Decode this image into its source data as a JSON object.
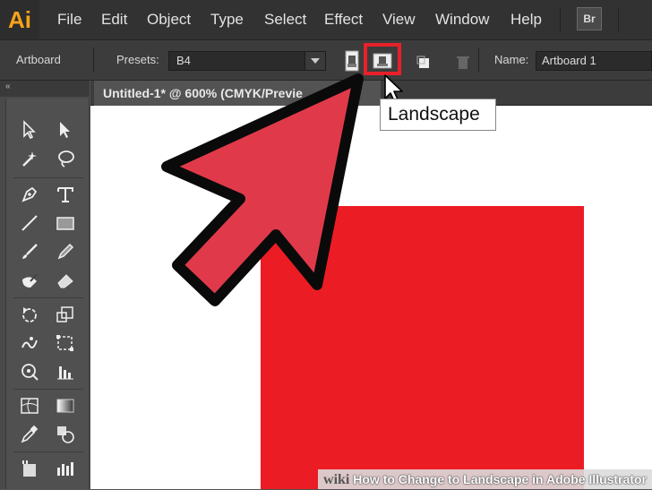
{
  "app": {
    "logo": "Ai",
    "bridge_label": "Br"
  },
  "menu": [
    "File",
    "Edit",
    "Object",
    "Type",
    "Select",
    "Effect",
    "View",
    "Window",
    "Help"
  ],
  "control_bar": {
    "context_label": "Artboard",
    "presets_label": "Presets:",
    "preset_value": "B4",
    "name_label": "Name:",
    "name_value": "Artboard 1"
  },
  "document_tab": {
    "title": "Untitled-1* @ 600% (CMYK/Previe"
  },
  "tooltip": {
    "text": "Landscape"
  },
  "collapse_glyph": "«",
  "watermark": {
    "brand": "wiki",
    "title": "How to Change to Landscape in Adobe Illustrator"
  },
  "colors": {
    "highlight": "#e82029",
    "arrow_fill": "#e03a4a",
    "artboard_shape": "#ec1c24",
    "logo": "#f7a21b"
  },
  "icons": [
    "selection-tool-icon",
    "direct-selection-tool-icon",
    "magic-wand-tool-icon",
    "lasso-tool-icon",
    "pen-tool-icon",
    "type-tool-icon",
    "line-tool-icon",
    "rectangle-tool-icon",
    "paintbrush-tool-icon",
    "pencil-tool-icon",
    "blob-brush-tool-icon",
    "eraser-tool-icon",
    "rotate-tool-icon",
    "scale-tool-icon",
    "warp-tool-icon",
    "free-transform-tool-icon",
    "symbol-sprayer-tool-icon",
    "column-graph-tool-icon",
    "mesh-tool-icon",
    "gradient-tool-icon",
    "eyedropper-tool-icon",
    "blend-tool-icon",
    "artboard-tool-icon",
    "slice-tool-icon",
    "portrait-orientation-icon",
    "landscape-orientation-icon",
    "move-artwork-icon",
    "delete-artboard-icon",
    "pointer-cursor-icon"
  ]
}
